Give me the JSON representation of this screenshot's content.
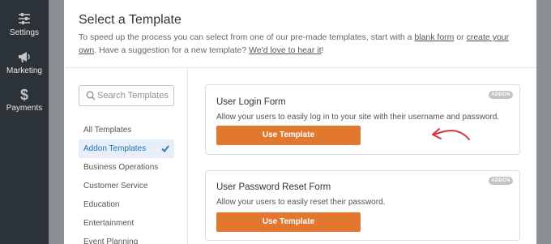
{
  "sidebar": {
    "items": [
      {
        "label": "Settings",
        "icon": "sliders-icon"
      },
      {
        "label": "Marketing",
        "icon": "megaphone-icon"
      },
      {
        "label": "Payments",
        "icon": "dollar-icon"
      }
    ]
  },
  "modal": {
    "title": "Select a Template",
    "desc_part1": "To speed up the process you can select from one of our pre-made templates, start with a ",
    "link_blank": "blank form",
    "desc_part2": " or ",
    "link_own": "create your own",
    "desc_part3": ". Have a suggestion for a new template? ",
    "link_hear": "We'd love to hear it",
    "desc_part4": "!"
  },
  "search": {
    "placeholder": "Search Templates"
  },
  "categories": [
    {
      "label": "All Templates"
    },
    {
      "label": "Addon Templates",
      "active": true
    },
    {
      "label": "Business Operations"
    },
    {
      "label": "Customer Service"
    },
    {
      "label": "Education"
    },
    {
      "label": "Entertainment"
    },
    {
      "label": "Event Planning"
    }
  ],
  "templates": [
    {
      "title": "User Login Form",
      "description": "Allow your users to easily log in to your site with their username and password.",
      "badge": "ADDON",
      "button": "Use Template"
    },
    {
      "title": "User Password Reset Form",
      "description": "Allow your users to easily reset their password.",
      "badge": "ADDON",
      "button": "Use Template"
    }
  ],
  "colors": {
    "accent_button": "#e27730",
    "active_category_text": "#2271b1",
    "arrow": "#d63638",
    "sidebar_bg": "#2c3338"
  }
}
